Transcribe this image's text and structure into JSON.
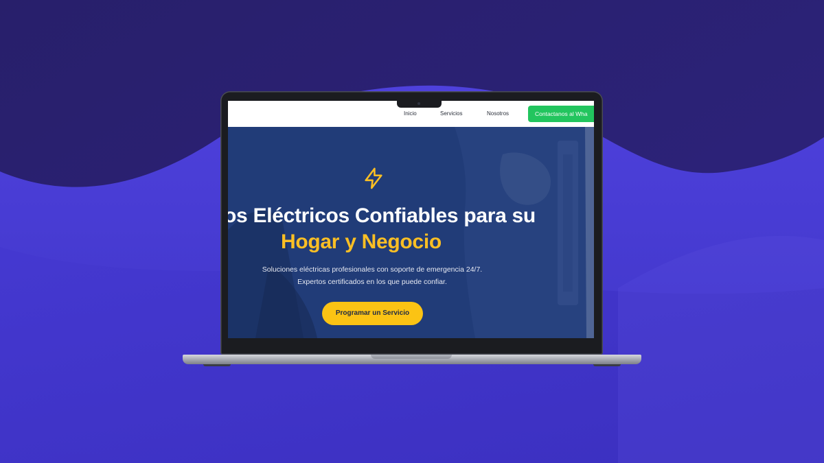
{
  "colors": {
    "bg_dark": "#2a1f6e",
    "bg_wave": "#4b3fd6",
    "hero_overlay": "#1f3a75",
    "accent_yellow": "#fbbf24",
    "whatsapp_green": "#22c55e"
  },
  "site": {
    "nav": {
      "links": [
        "Inicio",
        "Servicios",
        "Nosotros"
      ],
      "whatsapp_button": "Contactanos al Wha"
    },
    "hero": {
      "icon": "lightning-bolt-icon",
      "headline_line1": "ios Eléctricos Confiables para su",
      "headline_line2": "Hogar y Negocio",
      "subtitle_line1": "Soluciones eléctricas profesionales con soporte de emergencia 24/7.",
      "subtitle_line2": "Expertos certificados en los que puede confiar.",
      "cta_label": "Programar un Servicio"
    }
  }
}
